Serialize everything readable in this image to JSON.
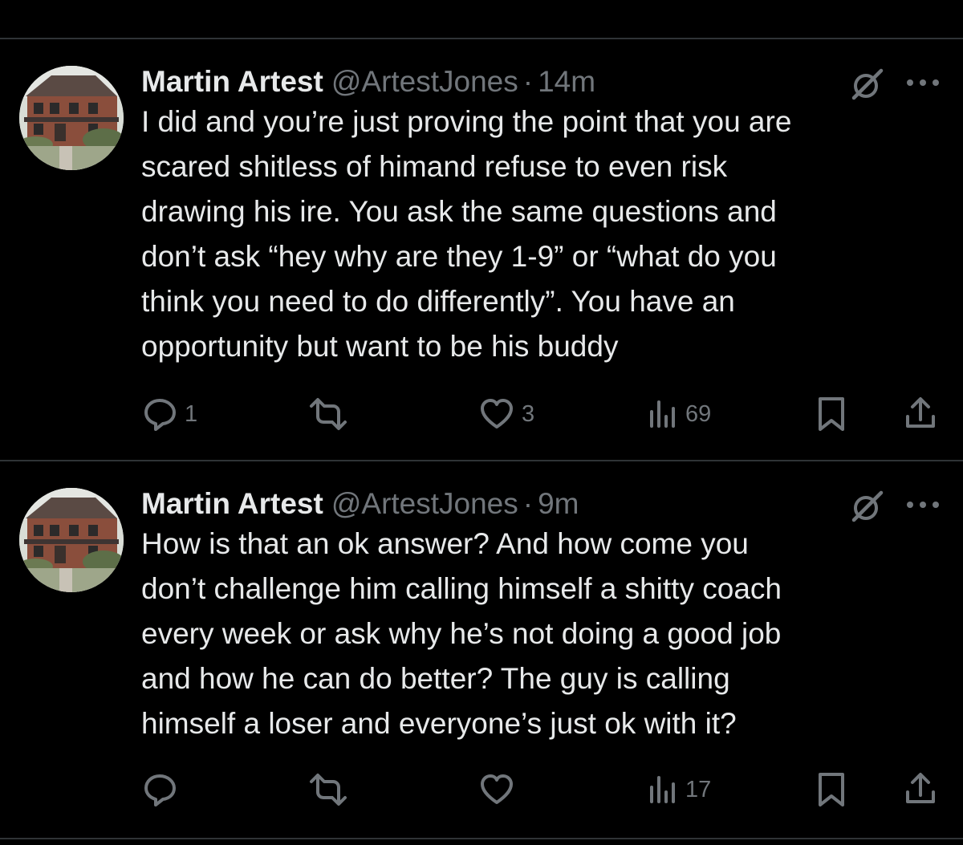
{
  "theme": {
    "background": "#000000",
    "text": "#e7e9ea",
    "muted": "#71767b",
    "divider": "#2f3336"
  },
  "tweets": [
    {
      "author_name": "Martin Artest",
      "handle": "@ArtestJones",
      "separator": "·",
      "time": "14m",
      "lines": [
        "I did and you’re just proving the point that you are",
        "scared shitless of himand refuse to even risk",
        "drawing his ire. You ask the same questions and",
        "don’t ask “hey why are they 1-9” or “what do you",
        "think you need to do differently”. You have an",
        "opportunity but want to be his buddy"
      ],
      "replies": "1",
      "reposts": "",
      "likes": "3",
      "views": "69",
      "icons": [
        "grok-icon",
        "more-icon",
        "reply-icon",
        "repost-icon",
        "like-icon",
        "views-icon",
        "bookmark-icon",
        "share-icon"
      ]
    },
    {
      "author_name": "Martin Artest",
      "handle": "@ArtestJones",
      "separator": "·",
      "time": "9m",
      "lines": [
        "How is that an ok answer? And how come you",
        "don’t challenge him calling himself a shitty coach",
        "every week or ask why he’s not doing a good job",
        "and how he can do better? The guy is calling",
        "himself a loser and everyone’s just ok with it?"
      ],
      "replies": "",
      "reposts": "",
      "likes": "",
      "views": "17",
      "icons": [
        "grok-icon",
        "more-icon",
        "reply-icon",
        "repost-icon",
        "like-icon",
        "views-icon",
        "bookmark-icon",
        "share-icon"
      ]
    }
  ]
}
